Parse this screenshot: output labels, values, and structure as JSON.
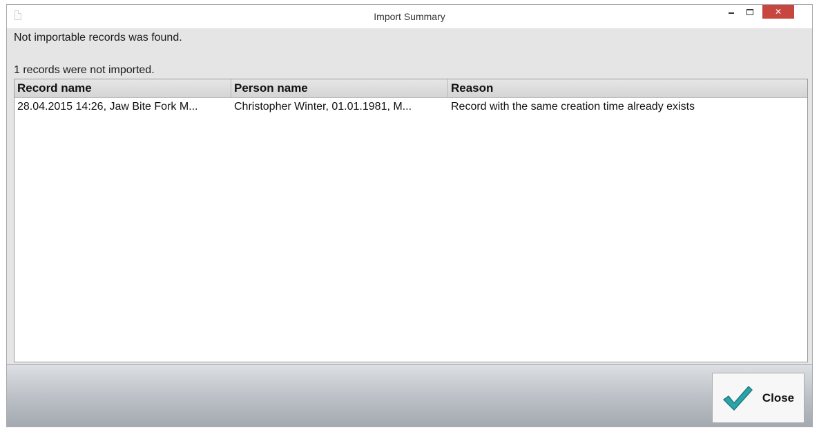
{
  "window": {
    "title": "Import Summary"
  },
  "status": {
    "line1": "Not importable records was found.",
    "line2": "1 records were not imported."
  },
  "table": {
    "columns": [
      "Record name",
      "Person name",
      "Reason"
    ],
    "rows": [
      [
        "28.04.2015 14:26, Jaw Bite Fork M...",
        "Christopher Winter, 01.01.1981, M...",
        "Record with the same creation time already exists"
      ]
    ]
  },
  "footer": {
    "close_label": "Close"
  },
  "colors": {
    "close_accent": "#c7463f",
    "check": "#2ba3a8"
  }
}
